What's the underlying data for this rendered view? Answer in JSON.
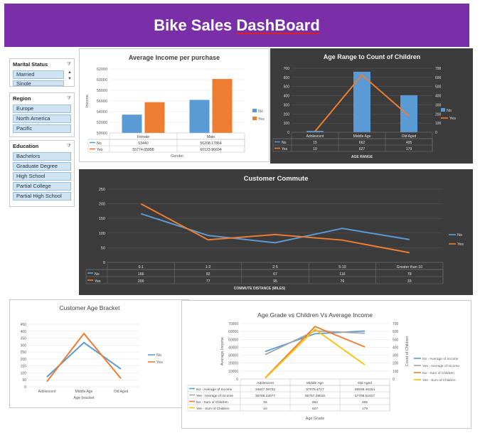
{
  "header": {
    "title_part1": "Bike Sales ",
    "title_part2": "DashBoard"
  },
  "slicers": {
    "marital": {
      "title": "Marital Status",
      "items": [
        "Married",
        "Single"
      ]
    },
    "region": {
      "title": "Region",
      "items": [
        "Europe",
        "North America",
        "Pacific"
      ]
    },
    "education": {
      "title": "Education",
      "items": [
        "Bachelors",
        "Graduate Degree",
        "High School",
        "Partial College",
        "Partial High School"
      ]
    }
  },
  "colors": {
    "header": "#7a2fa8",
    "no": "#5b9bd5",
    "yes": "#ed7d31",
    "gray": "#a5a5a5",
    "gold": "#ffc000"
  },
  "chart_data": [
    {
      "id": "income",
      "type": "bar",
      "title": "Average Income  per purchase",
      "xlabel": "Gender",
      "ylabel": "Income",
      "categories": [
        "Female",
        "Male"
      ],
      "ylim": [
        50000,
        62000
      ],
      "yticks": [
        "50000",
        "52000",
        "54000",
        "56000",
        "58000",
        "60000",
        "62000"
      ],
      "series": [
        {
          "name": "No",
          "values": [
            53440,
            56208.17864
          ],
          "labels": [
            "53440",
            "56208.17864"
          ]
        },
        {
          "name": "Yes",
          "values": [
            55774.05858,
            60123.96694
          ],
          "labels": [
            "55774.05858",
            "60123.96694"
          ]
        }
      ],
      "legend": "right"
    },
    {
      "id": "age_children",
      "type": "bar",
      "title": "Age Range to Count of Children",
      "xlabel": "AGE RANGE",
      "categories": [
        "Adolescent",
        "Middle Age",
        "Old Aged"
      ],
      "ylim": [
        0,
        700
      ],
      "yticks": [
        "0",
        "100",
        "200",
        "300",
        "400",
        "500",
        "600",
        "700"
      ],
      "series": [
        {
          "name": "No",
          "kind": "bar",
          "values": [
            15,
            662,
            405
          ],
          "labels": [
            "15",
            "662",
            "405"
          ]
        },
        {
          "name": "Yes",
          "kind": "line",
          "values": [
            10,
            627,
            179
          ],
          "labels": [
            "10",
            "627",
            "179"
          ]
        }
      ],
      "legend": "right"
    },
    {
      "id": "commute",
      "type": "line",
      "title": "Customer Commute",
      "xlabel": "COMMUTE DISTANCE (MILES)",
      "categories": [
        "0-1",
        "1-2",
        "2-5",
        "5-10",
        "Greater than 10"
      ],
      "ylim": [
        0,
        250
      ],
      "yticks": [
        "0",
        "50",
        "100",
        "150",
        "200",
        "250"
      ],
      "series": [
        {
          "name": "No",
          "values": [
            166,
            92,
            67,
            116,
            78
          ],
          "labels": [
            "166",
            "92",
            "67",
            "116",
            "78"
          ]
        },
        {
          "name": "Yes",
          "values": [
            200,
            77,
            95,
            76,
            33
          ],
          "labels": [
            "200",
            "77",
            "95",
            "76",
            "33"
          ]
        }
      ],
      "legend": "right"
    },
    {
      "id": "age_bracket",
      "type": "line",
      "title": "Customer Age Bracket",
      "xlabel": "Age  bracket",
      "categories": [
        "Adolescent",
        "Middle Age",
        "Old Aged"
      ],
      "ylim": [
        0,
        450
      ],
      "yticks": [
        "0",
        "50",
        "100",
        "150",
        "200",
        "250",
        "300",
        "350",
        "400",
        "450"
      ],
      "series": [
        {
          "name": "No",
          "values": [
            71,
            318,
            128
          ]
        },
        {
          "name": "Yes",
          "values": [
            38,
            383,
            60
          ]
        }
      ],
      "legend": "right"
    },
    {
      "id": "age_grade",
      "type": "line",
      "title": "Age Grade vs  Children Vs Average Income",
      "xlabel": "Age  Grade",
      "ylabel": "Average Income",
      "y2label": "Count of Children",
      "categories": [
        "Adolescent",
        "Middle Age",
        "Old Aged"
      ],
      "ylim": [
        0,
        70000
      ],
      "yticks": [
        "0",
        "10000",
        "20000",
        "30000",
        "40000",
        "50000",
        "60000",
        "70000"
      ],
      "y2lim": [
        0,
        700
      ],
      "y2ticks": [
        "0",
        "100",
        "200",
        "300",
        "400",
        "500",
        "600",
        "700"
      ],
      "series": [
        {
          "name": "No - Average of Income",
          "axis": "left",
          "values": [
            34647.38732,
            57075.4717,
            60538.46154
          ],
          "labels": [
            "34647.38732",
            "57075.4717",
            "60538.46154"
          ]
        },
        {
          "name": "Yes - Average of Income",
          "axis": "left",
          "values": [
            30769.23077,
            60757.28016,
            57706.61017
          ],
          "labels": [
            "30769.23077",
            "60757.28016",
            "57706.61017"
          ]
        },
        {
          "name": "No - Sum of Children",
          "axis": "right",
          "values": [
            15,
            662,
            405
          ],
          "labels": [
            "15",
            "662",
            "405"
          ]
        },
        {
          "name": "Yes - Sum of Children",
          "axis": "right",
          "values": [
            10,
            627,
            179
          ],
          "labels": [
            "10",
            "627",
            "179"
          ]
        }
      ],
      "legend": "right"
    }
  ]
}
